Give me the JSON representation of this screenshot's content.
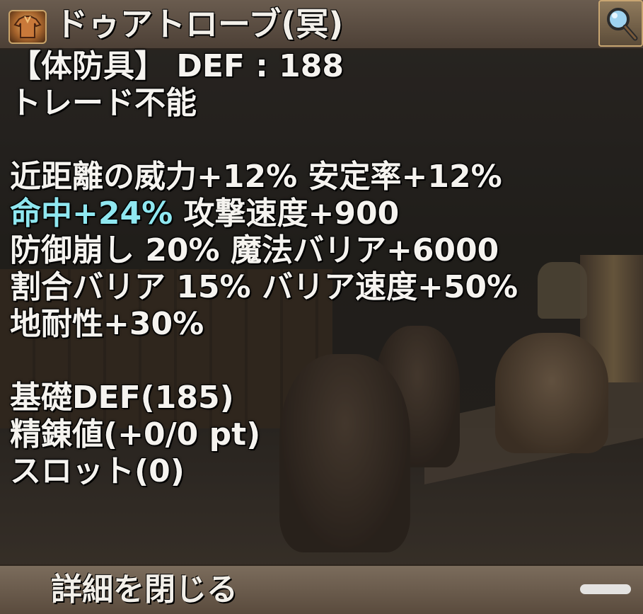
{
  "item": {
    "name": "ドゥアトローブ(冥)",
    "icon": "robe-item-icon"
  },
  "header": {
    "magnify_icon": "magnifier-icon"
  },
  "stats": {
    "line1": "【体防具】 DEF : 188",
    "line2": "トレード不能",
    "line3": "近距離の威力+12% 安定率+12%",
    "line4_highlight": "命中+24%",
    "line4_rest": " 攻撃速度+900",
    "line5": "防御崩し 20% 魔法バリア+6000",
    "line6": "割合バリア 15% バリア速度+50%",
    "line7": "地耐性+30%",
    "line8": "基礎DEF(185)",
    "line9": "精錬値(+0/0 pt)",
    "line10": "スロット(0)"
  },
  "footer": {
    "close_label": "詳細を閉じる"
  },
  "colors": {
    "highlight": "#8fe7f0",
    "text": "#f5f3ef",
    "header_bg": "#5a4c40"
  }
}
